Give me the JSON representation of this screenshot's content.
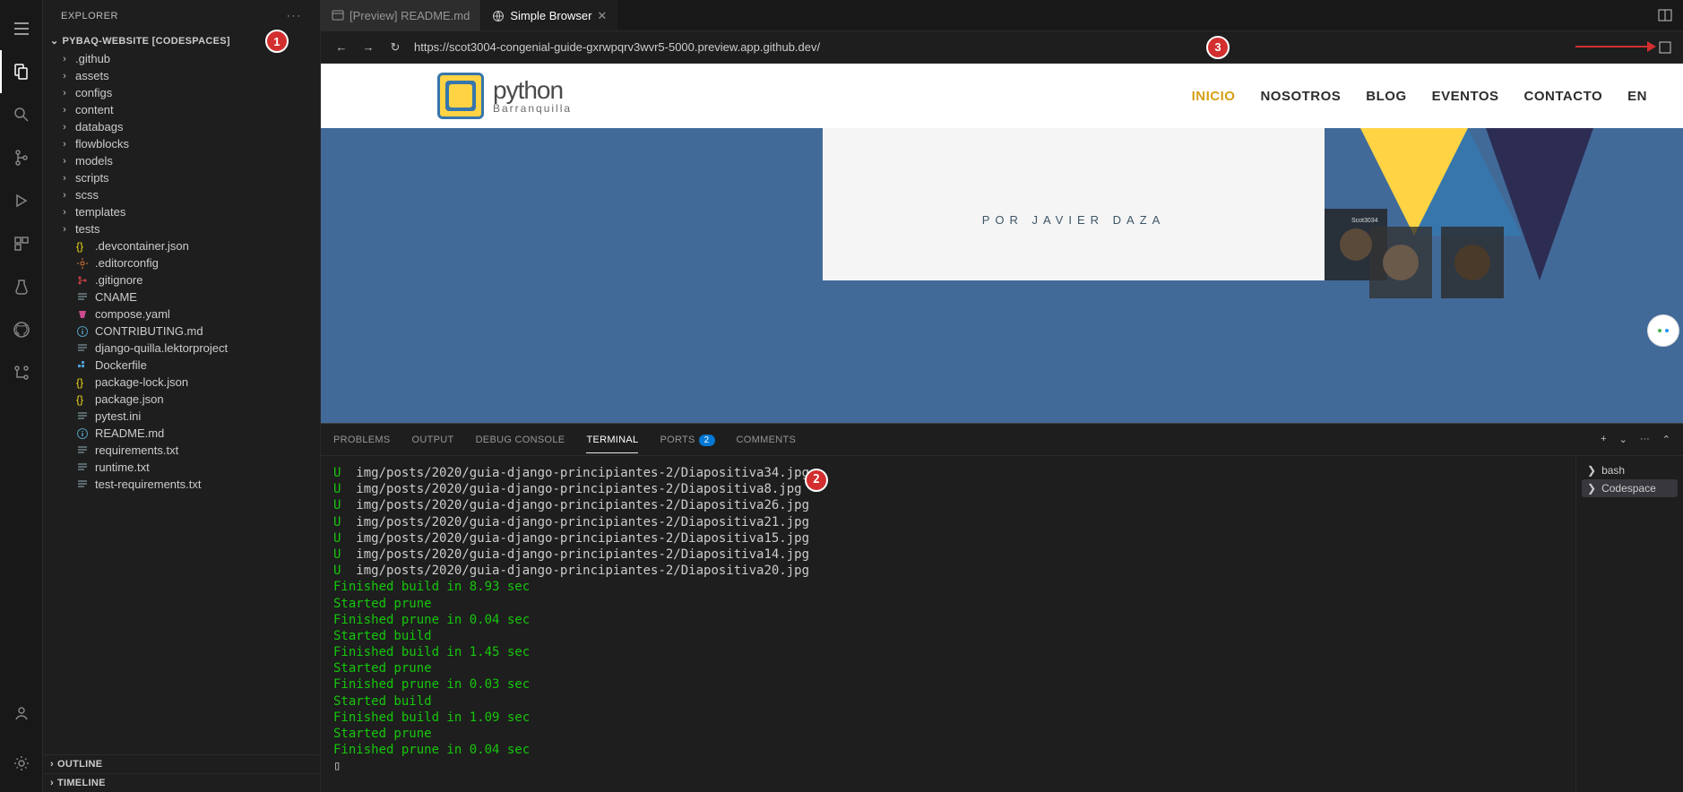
{
  "explorer": {
    "title": "EXPLORER",
    "project": "PYBAQ-WEBSITE [CODESPACES]",
    "folders": [
      ".github",
      "assets",
      "configs",
      "content",
      "databags",
      "flowblocks",
      "models",
      "scripts",
      "scss",
      "templates",
      "tests"
    ],
    "files": [
      {
        "name": ".devcontainer.json",
        "icon": "braces",
        "color": "#f5de19"
      },
      {
        "name": ".editorconfig",
        "icon": "gear",
        "color": "#e37933"
      },
      {
        "name": ".gitignore",
        "icon": "git",
        "color": "#cc3e44"
      },
      {
        "name": "CNAME",
        "icon": "lines",
        "color": "#6d8086"
      },
      {
        "name": "compose.yaml",
        "icon": "compose",
        "color": "#cb4b8f"
      },
      {
        "name": "CONTRIBUTING.md",
        "icon": "info",
        "color": "#519aba"
      },
      {
        "name": "django-quilla.lektorproject",
        "icon": "lines",
        "color": "#6d8086"
      },
      {
        "name": "Dockerfile",
        "icon": "docker",
        "color": "#4e9ed6"
      },
      {
        "name": "package-lock.json",
        "icon": "braces",
        "color": "#f5de19"
      },
      {
        "name": "package.json",
        "icon": "braces",
        "color": "#f5de19"
      },
      {
        "name": "pytest.ini",
        "icon": "lines",
        "color": "#6d8086"
      },
      {
        "name": "README.md",
        "icon": "info",
        "color": "#519aba"
      },
      {
        "name": "requirements.txt",
        "icon": "lines",
        "color": "#6d8086"
      },
      {
        "name": "runtime.txt",
        "icon": "lines",
        "color": "#6d8086"
      },
      {
        "name": "test-requirements.txt",
        "icon": "lines",
        "color": "#6d8086"
      }
    ],
    "outline": "OUTLINE",
    "timeline": "TIMELINE"
  },
  "tabs": {
    "preview": "[Preview] README.md",
    "browser": "Simple Browser"
  },
  "browser": {
    "url": "https://scot3004-congenial-guide-gxrwpqrv3wvr5-5000.preview.app.github.dev/"
  },
  "site": {
    "logo_main": "python",
    "logo_sub": "Barranquilla",
    "nav": [
      "INICIO",
      "NOSOTROS",
      "BLOG",
      "EVENTOS",
      "CONTACTO",
      "EN"
    ],
    "banner_by": "POR JAVIER DAZA",
    "avatar_label": "Scot3034"
  },
  "panel": {
    "tabs": {
      "problems": "PROBLEMS",
      "output": "OUTPUT",
      "debug": "DEBUG CONSOLE",
      "terminal": "TERMINAL",
      "ports": "PORTS",
      "ports_badge": "2",
      "comments": "COMMENTS"
    },
    "shell_items": [
      "bash",
      "Codespace"
    ],
    "lines": [
      {
        "s": "U",
        "t": "img/posts/2020/guia-django-principiantes-2/Diapositiva34.jpg"
      },
      {
        "s": "U",
        "t": "img/posts/2020/guia-django-principiantes-2/Diapositiva8.jpg"
      },
      {
        "s": "U",
        "t": "img/posts/2020/guia-django-principiantes-2/Diapositiva26.jpg"
      },
      {
        "s": "U",
        "t": "img/posts/2020/guia-django-principiantes-2/Diapositiva21.jpg"
      },
      {
        "s": "U",
        "t": "img/posts/2020/guia-django-principiantes-2/Diapositiva15.jpg"
      },
      {
        "s": "U",
        "t": "img/posts/2020/guia-django-principiantes-2/Diapositiva14.jpg"
      },
      {
        "s": "U",
        "t": "img/posts/2020/guia-django-principiantes-2/Diapositiva20.jpg"
      },
      {
        "g": "Finished build in 8.93 sec"
      },
      {
        "g": "Started prune"
      },
      {
        "g": "Finished prune in 0.04 sec"
      },
      {
        "g": "Started build"
      },
      {
        "g": "Finished build in 1.45 sec"
      },
      {
        "g": "Started prune"
      },
      {
        "g": "Finished prune in 0.03 sec"
      },
      {
        "g": "Started build"
      },
      {
        "g": "Finished build in 1.09 sec"
      },
      {
        "g": "Started prune"
      },
      {
        "g": "Finished prune in 0.04 sec"
      }
    ]
  },
  "callouts": {
    "one": "1",
    "two": "2",
    "three": "3"
  }
}
